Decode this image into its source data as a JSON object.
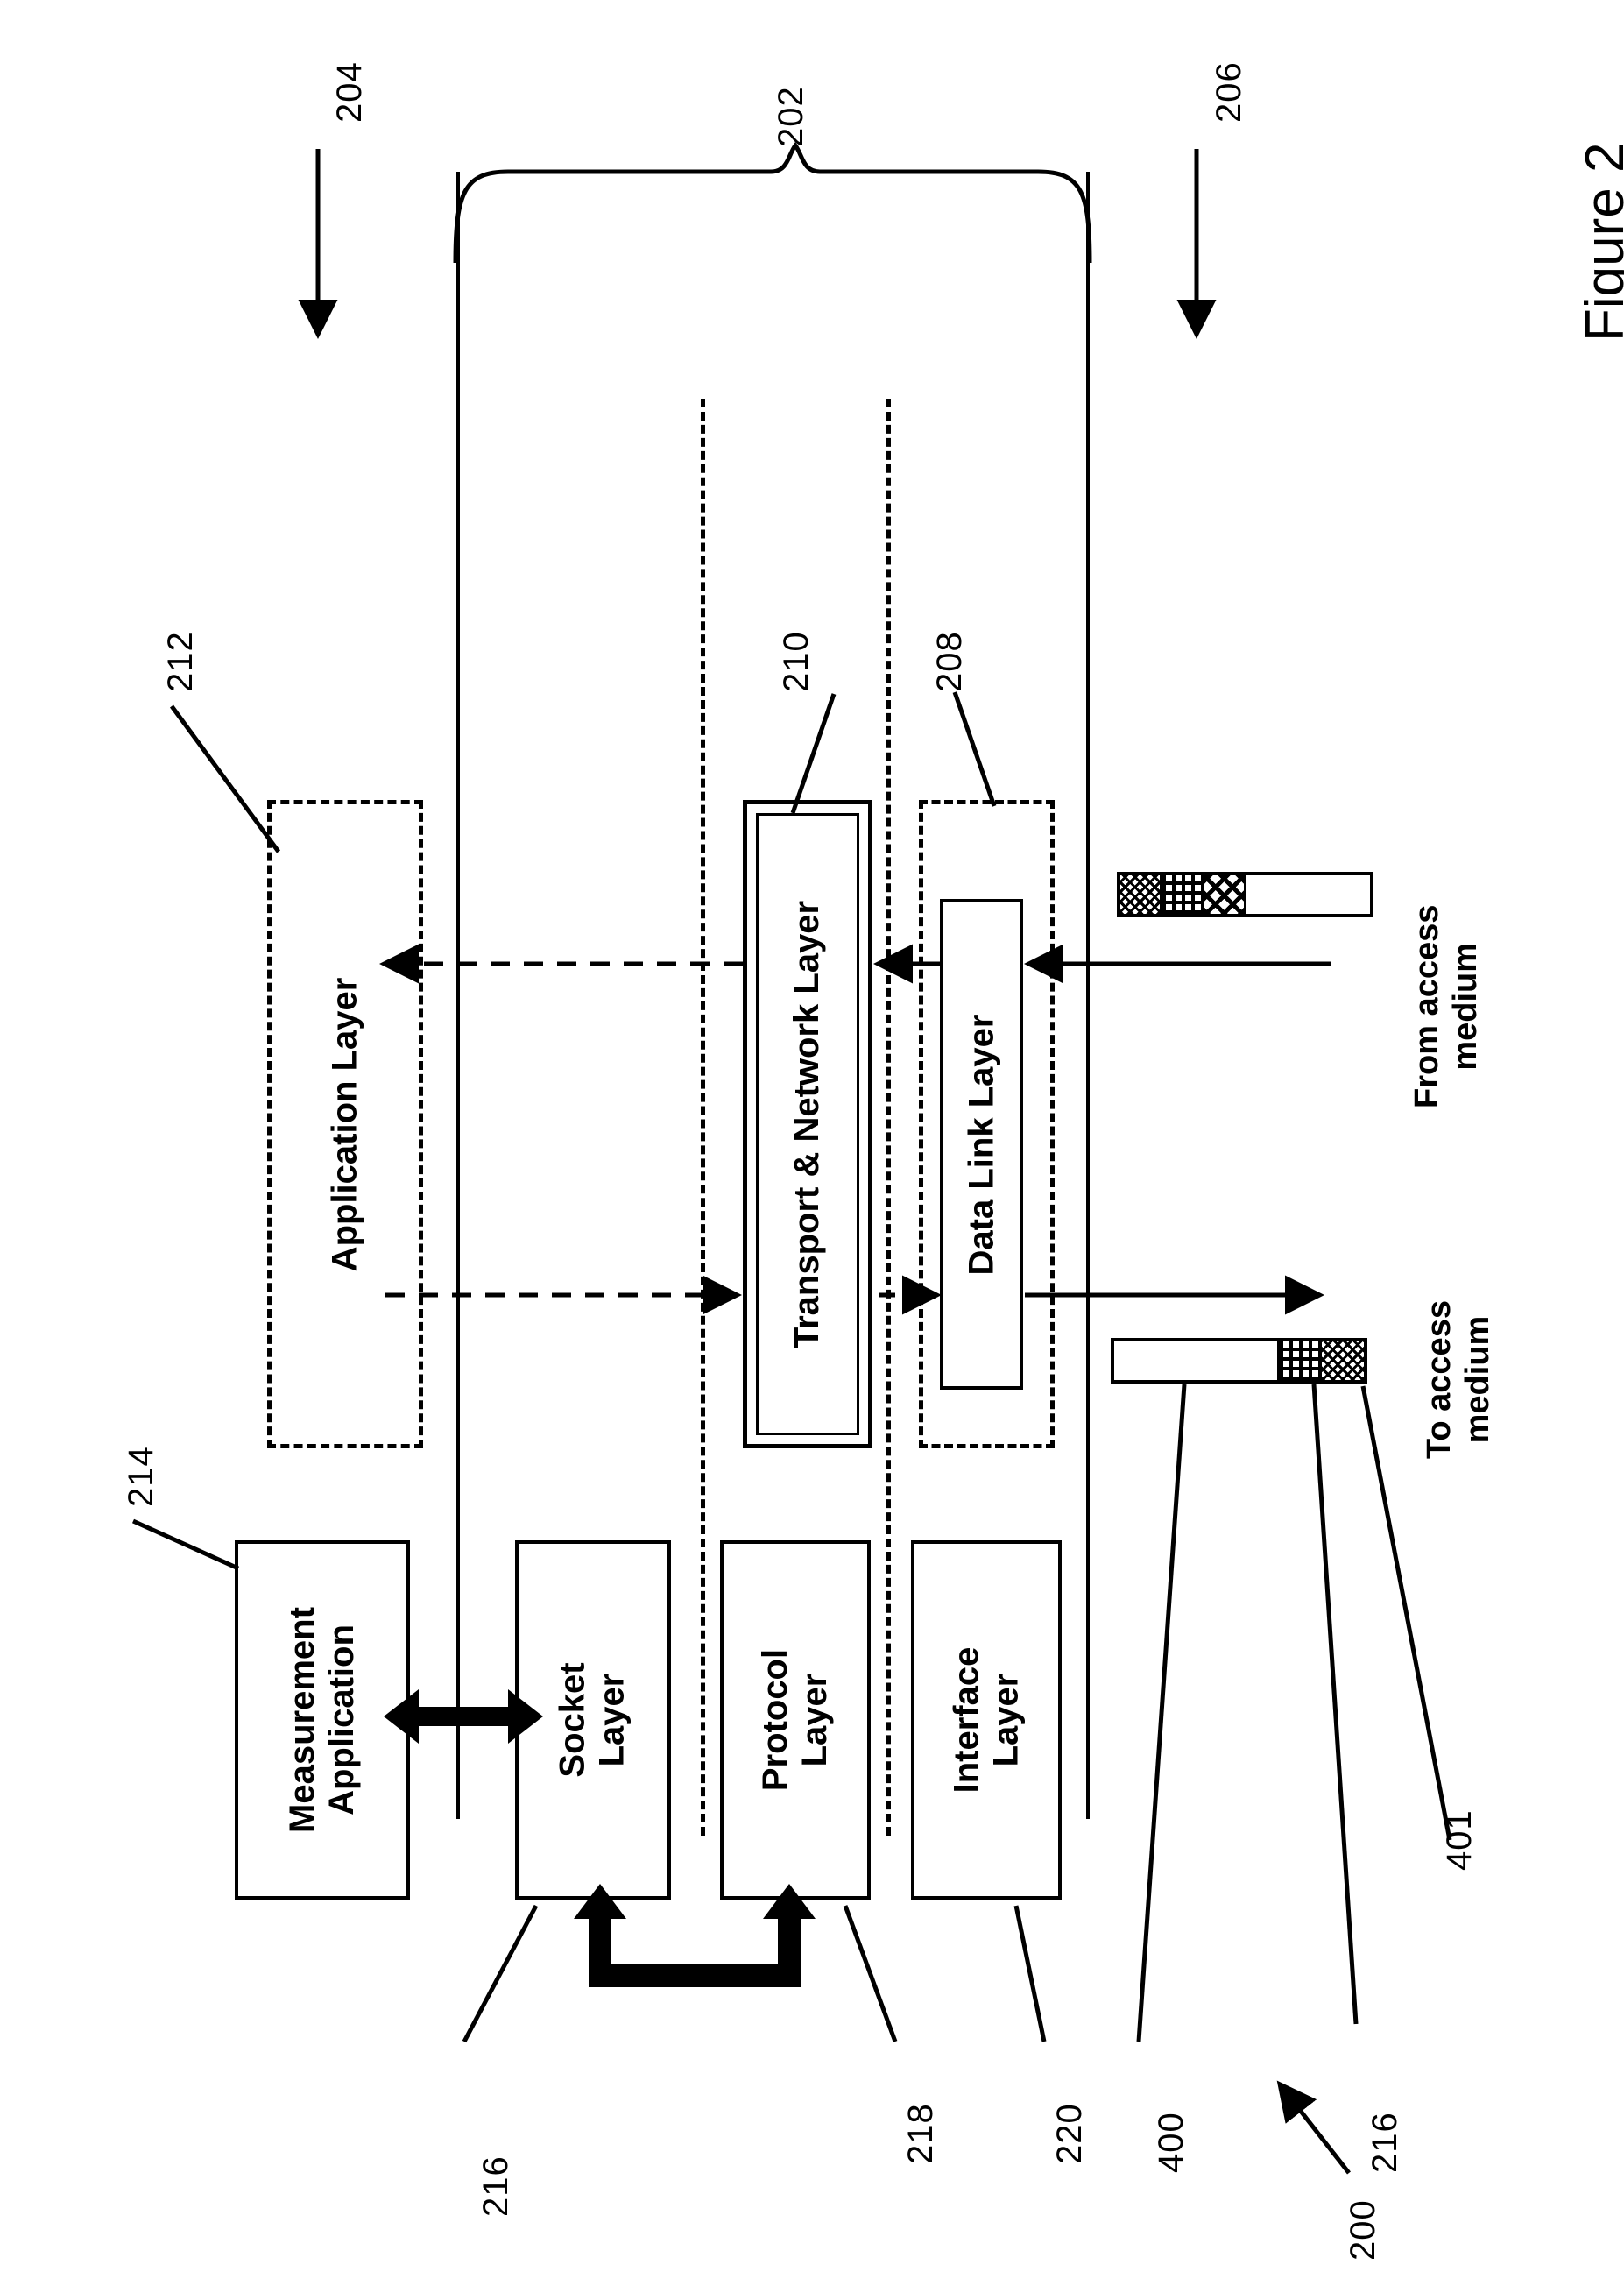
{
  "figure": {
    "title": "Figure 2",
    "overall_ref": "200"
  },
  "brace": {
    "ref": "202"
  },
  "side_refs": {
    "upper_stack": "204",
    "lower_stack": "206"
  },
  "layers_right": [
    {
      "ref": "212",
      "label": "Application Layer",
      "style": "dashed"
    },
    {
      "ref": "210",
      "label": "Transport & Network Layer",
      "style": "double"
    },
    {
      "ref": "208",
      "label": "Data Link Layer",
      "style": "solid-in-dashed"
    }
  ],
  "layers_left": [
    {
      "ref": "214",
      "label": "Measurement\nApplication",
      "style": "solid"
    },
    {
      "ref": "216",
      "label": "Socket\nLayer",
      "style": "solid"
    },
    {
      "ref": "218",
      "label": "Protocol\nLayer",
      "style": "solid"
    },
    {
      "ref": "220",
      "label": "Interface\nLayer",
      "style": "solid"
    }
  ],
  "medium": {
    "from_label": "From access\nmedium",
    "to_label": "To access\nmedium"
  },
  "packets": {
    "incoming": {
      "ref": null,
      "segments": [
        "header-a",
        "header-b",
        "header-c",
        "payload"
      ]
    },
    "outgoing": {
      "ref_payload": "400",
      "ref_header": "216",
      "ref_trailer": "401",
      "segments": [
        "payload",
        "header-b",
        "header-a"
      ]
    }
  },
  "refs_all": [
    "200",
    "202",
    "204",
    "206",
    "208",
    "210",
    "212",
    "214",
    "216",
    "218",
    "220",
    "400",
    "401"
  ]
}
